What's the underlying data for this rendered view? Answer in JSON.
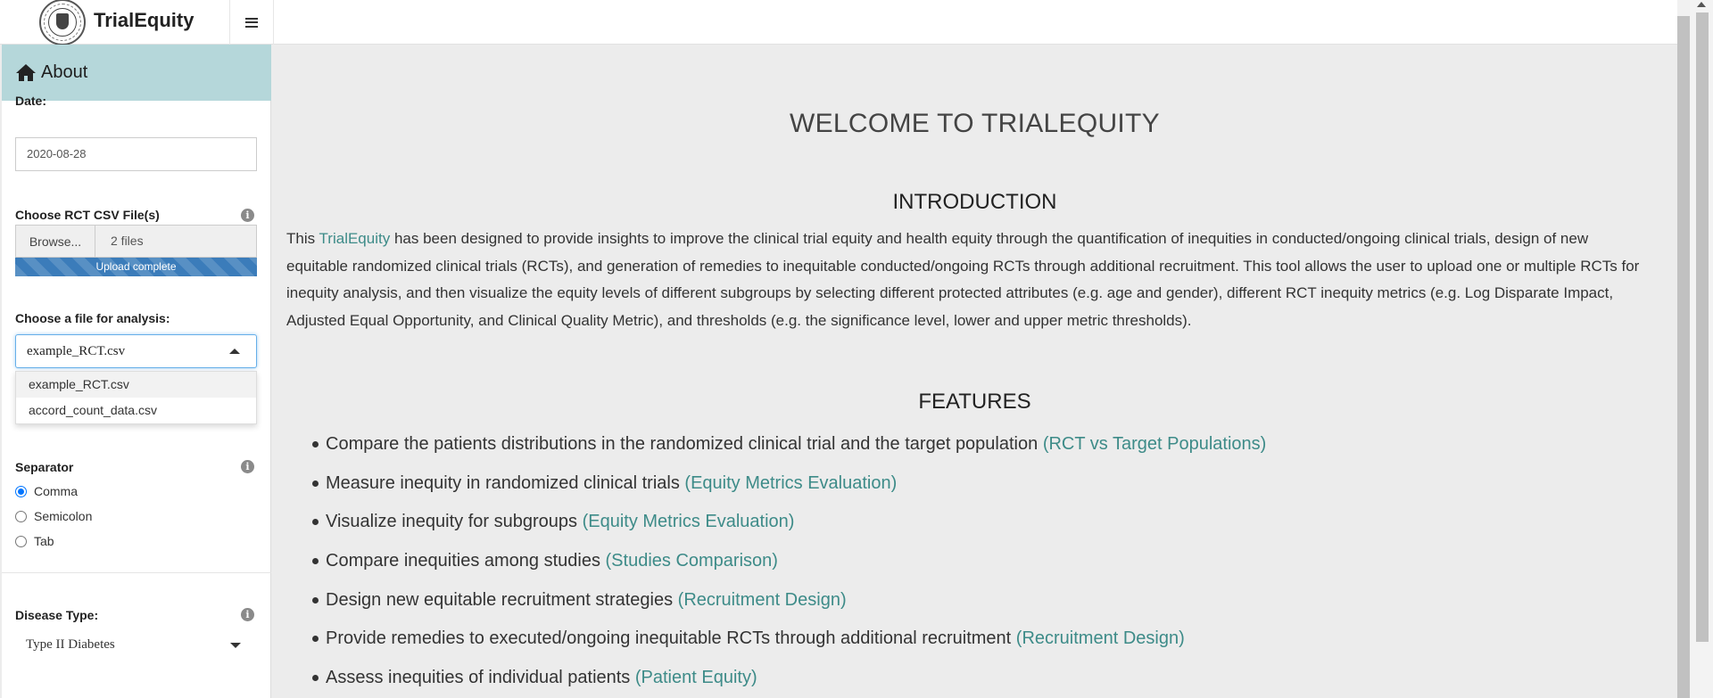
{
  "header": {
    "app_title": "TrialEquity",
    "logo_icon": "university-seal-icon",
    "menu_icon": "hamburger-icon"
  },
  "sidebar": {
    "about_label": "About",
    "date": {
      "label": "Date:",
      "value": "2020-08-28"
    },
    "rct_files": {
      "label": "Choose RCT CSV File(s)",
      "browse_label": "Browse...",
      "file_count": "2 files",
      "progress_text": "Upload complete",
      "progress_percent": 100
    },
    "analysis_file": {
      "label": "Choose a file for analysis:",
      "value": "example_RCT.csv",
      "options": [
        "example_RCT.csv",
        "accord_count_data.csv"
      ]
    },
    "separator": {
      "label": "Separator",
      "options": [
        "Comma",
        "Semicolon",
        "Tab"
      ],
      "selected": "Comma"
    },
    "disease_type": {
      "label": "Disease Type:",
      "value": "Type II Diabetes"
    }
  },
  "main": {
    "welcome": "WELCOME TO TRIALEQUITY",
    "intro_heading": "INTRODUCTION",
    "intro": {
      "prefix": "This ",
      "link": "TrialEquity",
      "body": " has been designed to provide insights to improve the clinical trial equity and health equity through the quantification of inequities in conducted/ongoing clinical trials, design of new equitable randomized clinical trials (RCTs), and generation of remedies to inequitable conducted/ongoing RCTs through additional recruitment. This tool allows the user to upload one or multiple RCTs for inequity analysis, and then visualize the equity levels of different subgroups by selecting different protected attributes (e.g. age and gender), different RCT inequity metrics (e.g. Log Disparate Impact, Adjusted Equal Opportunity, and Clinical Quality Metric), and thresholds (e.g. the significance level, lower and upper metric thresholds)."
    },
    "features_heading": "FEATURES",
    "features": [
      {
        "text": "Compare the patients distributions in the randomized clinical trial and the target population ",
        "link": "(RCT vs Target Populations)"
      },
      {
        "text": "Measure inequity in randomized clinical trials ",
        "link": "(Equity Metrics Evaluation)"
      },
      {
        "text": "Visualize inequity for subgroups ",
        "link": "(Equity Metrics Evaluation)"
      },
      {
        "text": "Compare inequities among studies ",
        "link": "(Studies Comparison)"
      },
      {
        "text": "Design new equitable recruitment strategies ",
        "link": "(Recruitment Design)"
      },
      {
        "text": "Provide remedies to executed/ongoing inequitable RCTs through additional recruitment ",
        "link": "(Recruitment Design)"
      },
      {
        "text": "Assess inequities of individual patients ",
        "link": "(Patient Equity)"
      }
    ]
  },
  "colors": {
    "sidebar_active": "#b5d7da",
    "link": "#3d8b88",
    "progress": "#3b7cba"
  }
}
